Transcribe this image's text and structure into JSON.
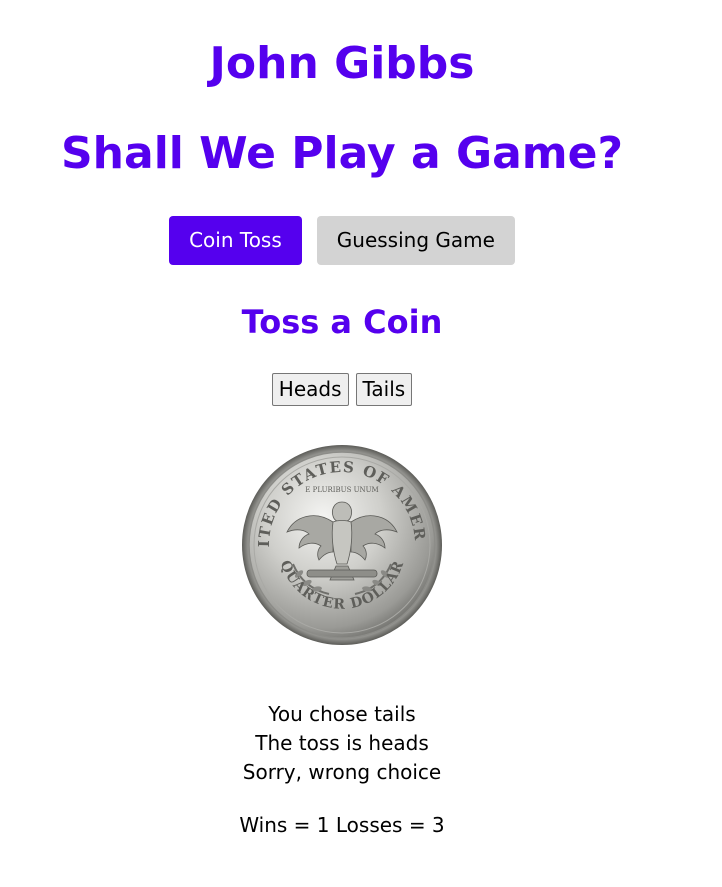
{
  "header": {
    "author": "John Gibbs",
    "headline": "Shall We Play a Game?"
  },
  "tabs": [
    {
      "label": "Coin Toss",
      "active": true
    },
    {
      "label": "Guessing Game",
      "active": false
    }
  ],
  "coin_toss": {
    "title": "Toss a Coin",
    "heads_label": "Heads",
    "tails_label": "Tails",
    "coin_image": "quarter-dollar-reverse",
    "coin_text_top": "UNITED STATES OF AMERICA",
    "coin_text_motto": "E PLURIBUS UNUM",
    "coin_text_bottom": "QUARTER DOLLAR",
    "result_choice": "You chose tails",
    "result_toss": "The toss is heads",
    "result_verdict": "Sorry, wrong choice",
    "score": "Wins = 1 Losses = 3"
  },
  "colors": {
    "accent": "#5500ee",
    "inactive_tab": "#d3d3d3"
  }
}
